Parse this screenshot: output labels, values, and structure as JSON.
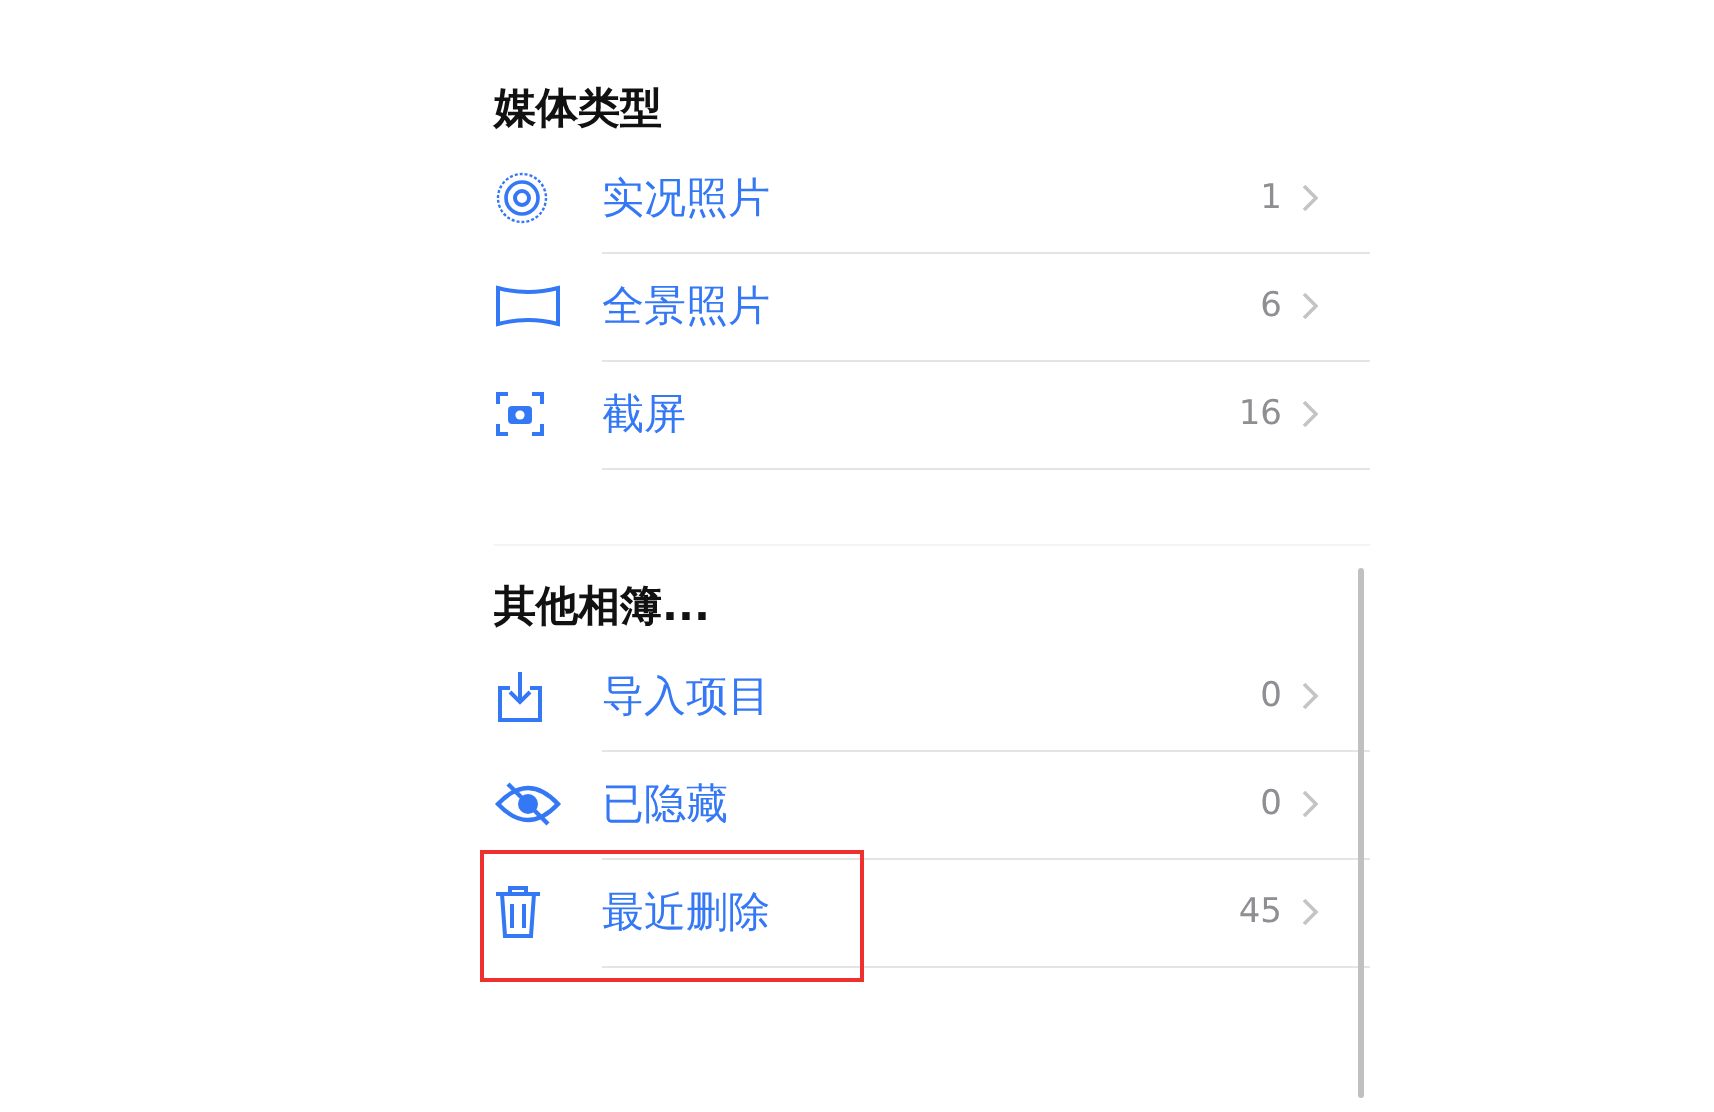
{
  "sections": [
    {
      "title": "媒体类型",
      "items": [
        {
          "kind": "live",
          "label": "实况照片",
          "count": "1",
          "highlighted": false
        },
        {
          "kind": "panorama",
          "label": "全景照片",
          "count": "6",
          "highlighted": false
        },
        {
          "kind": "screenshot",
          "label": "截屏",
          "count": "16",
          "highlighted": false
        }
      ]
    },
    {
      "title": "其他相簿...",
      "items": [
        {
          "kind": "import",
          "label": "导入项目",
          "count": "0",
          "highlighted": false
        },
        {
          "kind": "hidden",
          "label": "已隐藏",
          "count": "0",
          "highlighted": false
        },
        {
          "kind": "trash",
          "label": "最近删除",
          "count": "45",
          "highlighted": true
        }
      ]
    }
  ]
}
